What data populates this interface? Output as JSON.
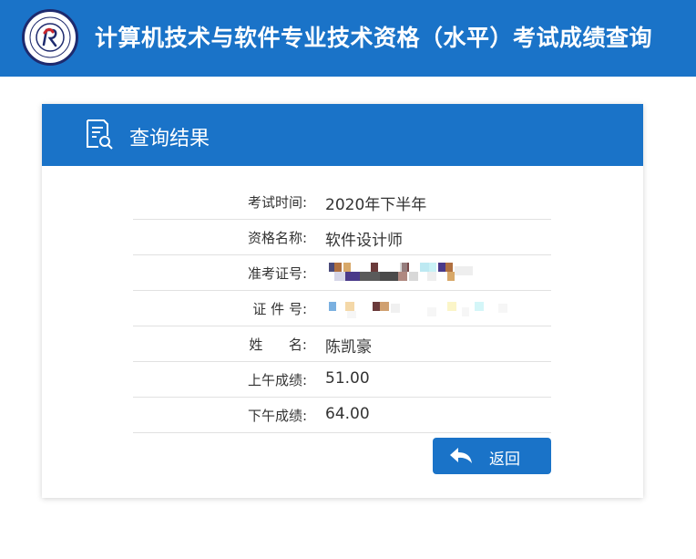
{
  "header": {
    "logo_icon": "exam-seal-logo",
    "title": "计算机技术与软件专业技术资格（水平）考试成绩查询"
  },
  "result_card": {
    "icon": "document-search-icon",
    "title": "查询结果",
    "rows": [
      {
        "label": "考试时间:",
        "value": "2020年下半年"
      },
      {
        "label": "资格名称:",
        "value": "软件设计师"
      },
      {
        "label": "准考证号:",
        "value": ""
      },
      {
        "label": "证 件 号:",
        "value": ""
      },
      {
        "label": "姓      名:",
        "value": "陈凯豪"
      },
      {
        "label": "上午成绩:",
        "value": "51.00"
      },
      {
        "label": "下午成绩:",
        "value": "64.00"
      }
    ],
    "back_button": {
      "icon": "back-arrow-icon",
      "label": "返回"
    }
  },
  "colors": {
    "primary": "#1a73c8",
    "text": "#333333",
    "divider": "#e1e1e1"
  }
}
